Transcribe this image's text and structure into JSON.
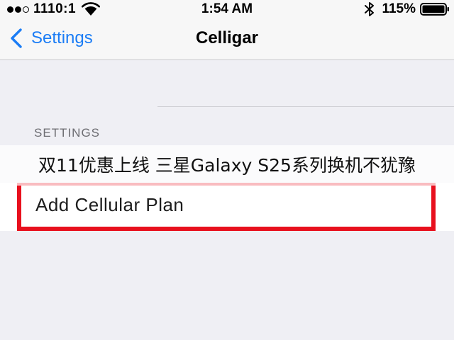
{
  "status_bar": {
    "carrier": "1110:1",
    "time": "1:54 AM",
    "battery": "115%"
  },
  "nav": {
    "back_label": "Settings",
    "title": "Celligar"
  },
  "section": {
    "header": "SETTINGS"
  },
  "row": {
    "label": "Add Cellular Plan"
  },
  "overlay": {
    "text": "双11优惠上线 三星Galaxy S25系列换机不犹豫"
  },
  "colors": {
    "accent": "#1a7cf5",
    "highlight": "#e8101e",
    "background": "#efeff4",
    "bar": "#f7f7f7"
  }
}
